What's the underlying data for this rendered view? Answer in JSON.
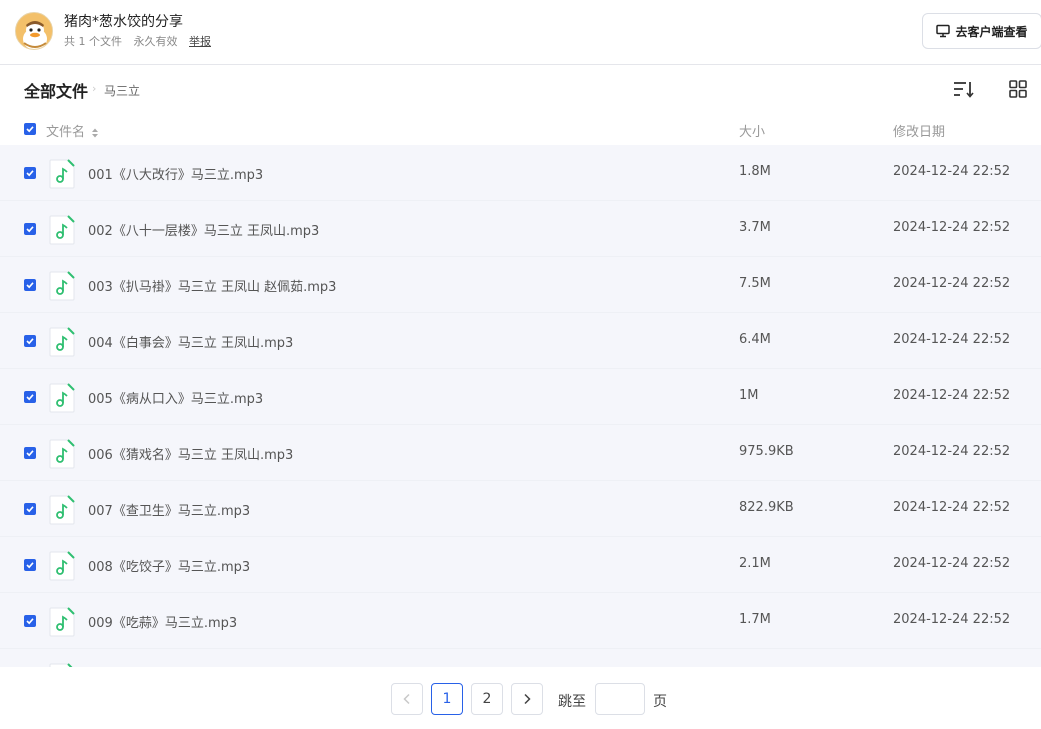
{
  "header": {
    "title": "猪肉*葱水饺的分享",
    "file_count": "共 1 个文件",
    "validity": "永久有效",
    "report": "举报",
    "client_button": "去客户端查看"
  },
  "breadcrumb": {
    "root": "全部文件",
    "separator": "›",
    "current": "马三立"
  },
  "table": {
    "columns": {
      "name": "文件名",
      "size": "大小",
      "date": "修改日期"
    },
    "rows": [
      {
        "name": "001《八大改行》马三立.mp3",
        "size": "1.8M",
        "date": "2024-12-24 22:52"
      },
      {
        "name": "002《八十一层楼》马三立 王凤山.mp3",
        "size": "3.7M",
        "date": "2024-12-24 22:52"
      },
      {
        "name": "003《扒马褂》马三立 王凤山 赵佩茹.mp3",
        "size": "7.5M",
        "date": "2024-12-24 22:52"
      },
      {
        "name": "004《白事会》马三立 王凤山.mp3",
        "size": "6.4M",
        "date": "2024-12-24 22:52"
      },
      {
        "name": "005《病从口入》马三立.mp3",
        "size": "1M",
        "date": "2024-12-24 22:52"
      },
      {
        "name": "006《猜戏名》马三立 王凤山.mp3",
        "size": "975.9KB",
        "date": "2024-12-24 22:52"
      },
      {
        "name": "007《查卫生》马三立.mp3",
        "size": "822.9KB",
        "date": "2024-12-24 22:52"
      },
      {
        "name": "008《吃饺子》马三立.mp3",
        "size": "2.1M",
        "date": "2024-12-24 22:52"
      },
      {
        "name": "009《吃蒜》马三立.mp3",
        "size": "1.7M",
        "date": "2024-12-24 22:52"
      }
    ]
  },
  "pagination": {
    "pages": [
      "1",
      "2"
    ],
    "current": "1",
    "jump_label": "跳至",
    "jump_unit": "页",
    "prev_icon": "chevron-left-icon",
    "next_icon": "chevron-right-icon"
  },
  "colors": {
    "accent": "#2861e8",
    "row_background": "#f5f6fb",
    "audio_icon": "#2fbf71"
  }
}
